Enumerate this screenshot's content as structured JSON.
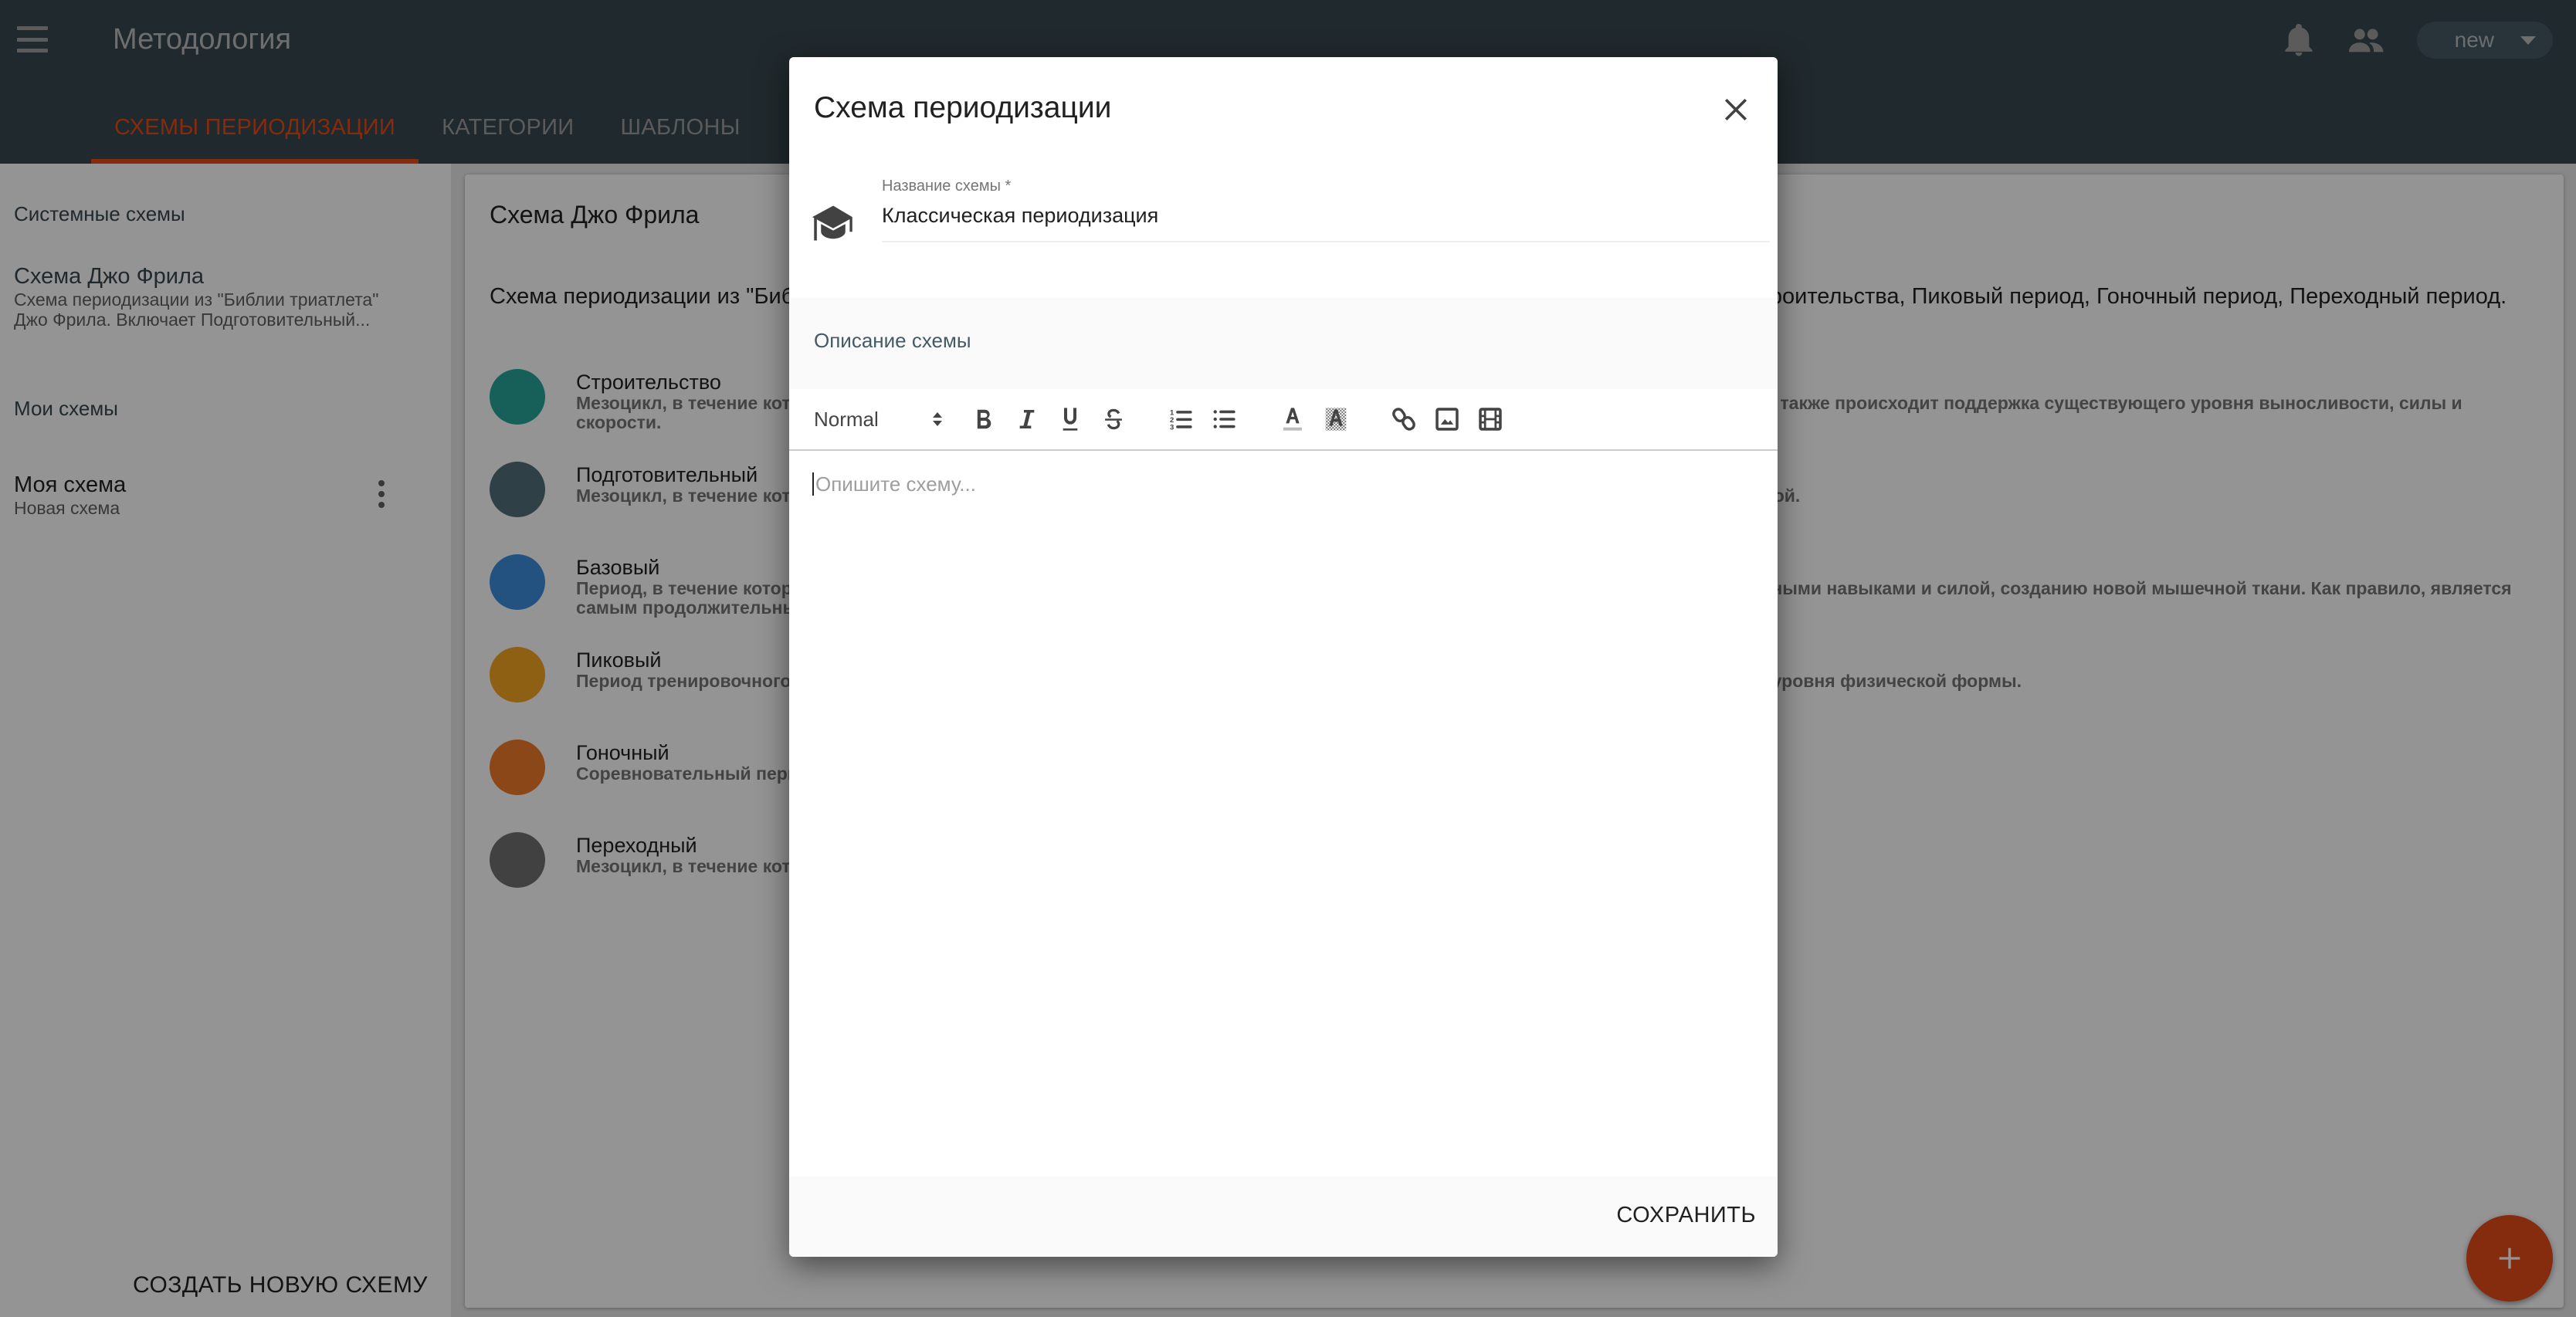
{
  "appbar": {
    "title": "Методология",
    "tabs": [
      {
        "label": "СХЕМЫ ПЕРИОДИЗАЦИИ",
        "active": true
      },
      {
        "label": "КАТЕГОРИИ",
        "active": false
      },
      {
        "label": "ШАБЛОНЫ",
        "active": false
      }
    ],
    "icons": [
      "menu-icon",
      "bell-icon",
      "people-icon"
    ],
    "user_chip": "new"
  },
  "sidebar": {
    "system_header": "Системные схемы",
    "system_items": [
      {
        "title": "Схема Джо Фрила",
        "subtitle_line1": "Схема периодизации из \"Библии триатлета\"",
        "subtitle_line2": "Джо Фрила. Включает Подготовительный..."
      }
    ],
    "my_header": "Мои схемы",
    "my_items": [
      {
        "title": "Моя схема",
        "subtitle": "Новая схема"
      }
    ],
    "create_button": "СОЗДАТЬ НОВУЮ СХЕМУ"
  },
  "main": {
    "title": "Схема Джо Фрила",
    "description": "Схема периодизации из \"Библии триатлета\" Джо Фрила. Включает Подготовительный период, Базовый период, период Строительства, Пиковый период, Гоночный период, Переходный период.",
    "phases": [
      {
        "name": "Строительство",
        "color": "#26a69a",
        "desc": "Мезоцикл, в течение которого развиваются специфические навыки, улучшаются показатели анаэробной выносливости и мощности, а также происходит поддержка существующего уровня выносливости, силы и скорости."
      },
      {
        "name": "Подготовительный",
        "color": "#546e7a",
        "desc": "Мезоцикл, в течение которого спортсмен готовится к тренировкам, проводятся смешанные тренировки и тренировки с низкой нагрузкой."
      },
      {
        "name": "Базовый",
        "color": "#3f8edc",
        "desc": "Период, в течение которого закладывается общая физическая база. Основное внимание уделяется работе с выносливостью, скоростными навыками и силой, созданию новой мышечной ткани. Как правило, является самым продолжительным периодом."
      },
      {
        "name": "Пиковый",
        "color": "#f5a623",
        "desc": "Период тренировочного процесса, в котором снижается объём и повышается интенсивность, что позволяет достичь более высокого уровня физической формы."
      },
      {
        "name": "Гоночный",
        "color": "#f07a2a",
        "desc": "Соревновательный период."
      },
      {
        "name": "Переходный",
        "color": "#707070",
        "desc": "Мезоцикл, в течение которого снижается нагрузка с целью восстановления после тренировок и гонок."
      }
    ],
    "fab_icon": "plus-icon"
  },
  "modal": {
    "title": "Схема периодизации",
    "name_label": "Название схемы *",
    "name_value": "Классическая периодизация",
    "description_label": "Описание схемы",
    "toolbar": {
      "format_value": "Normal",
      "buttons": [
        "bold",
        "italic",
        "underline",
        "strikethrough",
        "ordered-list",
        "bullet-list",
        "text-color",
        "background-color",
        "link",
        "image",
        "video"
      ]
    },
    "editor_placeholder": "Опишите схему...",
    "save_button": "СОХРАНИТЬ"
  },
  "colors": {
    "appbar": "#37474f",
    "accent": "#e64a19",
    "overlay": "rgba(0,0,0,0.42)"
  }
}
